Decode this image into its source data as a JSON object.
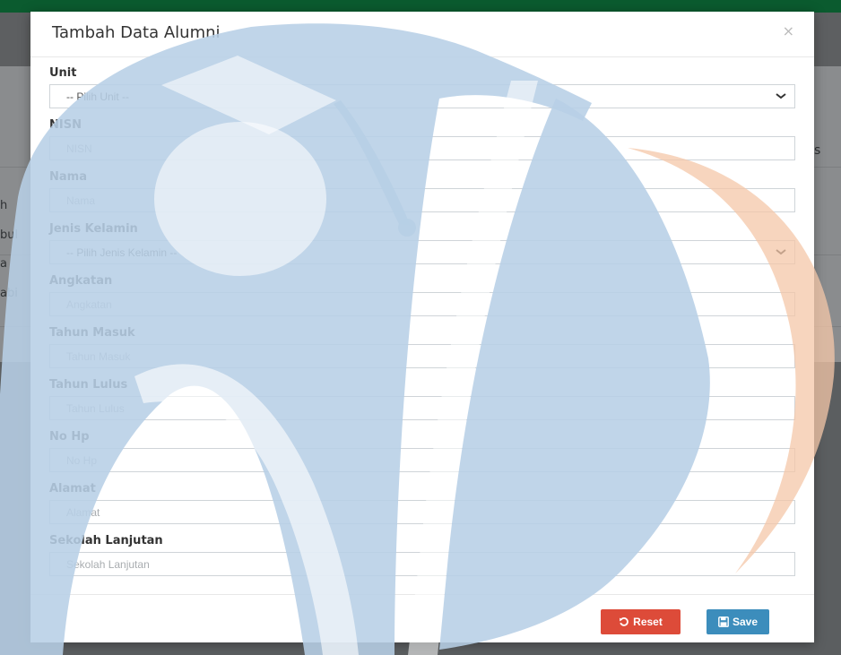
{
  "background": {
    "side_fragments": [
      "h",
      "bul",
      "a",
      "abi"
    ],
    "right_fragment": "s"
  },
  "modal": {
    "title": "Tambah Data Alumni",
    "close_symbol": "×",
    "fields": [
      {
        "label": "Unit",
        "type": "select",
        "value": "-- Pilih Unit --"
      },
      {
        "label": "NISN",
        "type": "text",
        "placeholder": "NISN"
      },
      {
        "label": "Nama",
        "type": "text",
        "placeholder": "Nama"
      },
      {
        "label": "Jenis Kelamin",
        "type": "select",
        "value": "-- Pilih Jenis Kelamin --"
      },
      {
        "label": "Angkatan",
        "type": "text",
        "placeholder": "Angkatan"
      },
      {
        "label": "Tahun Masuk",
        "type": "text",
        "placeholder": "Tahun Masuk"
      },
      {
        "label": "Tahun Lulus",
        "type": "text",
        "placeholder": "Tahun Lulus"
      },
      {
        "label": "No Hp",
        "type": "text",
        "placeholder": "No Hp"
      },
      {
        "label": "Alamat",
        "type": "text",
        "placeholder": "Alamat"
      },
      {
        "label": "Sekolah Lanjutan",
        "type": "text",
        "placeholder": "Sekolah Lanjutan"
      }
    ],
    "buttons": {
      "reset_label": "Reset",
      "save_label": "Save"
    }
  },
  "colors": {
    "topbar": "#0b5b2f",
    "reset": "#dd4b39",
    "save": "#3c8dbc",
    "watermark_blue": "#b7cfe6",
    "watermark_orange": "#f4c7a8"
  },
  "icons": {
    "close": "close-icon",
    "chevron": "chevron-down-icon",
    "reset": "undo-icon",
    "save": "floppy-disk-icon"
  }
}
